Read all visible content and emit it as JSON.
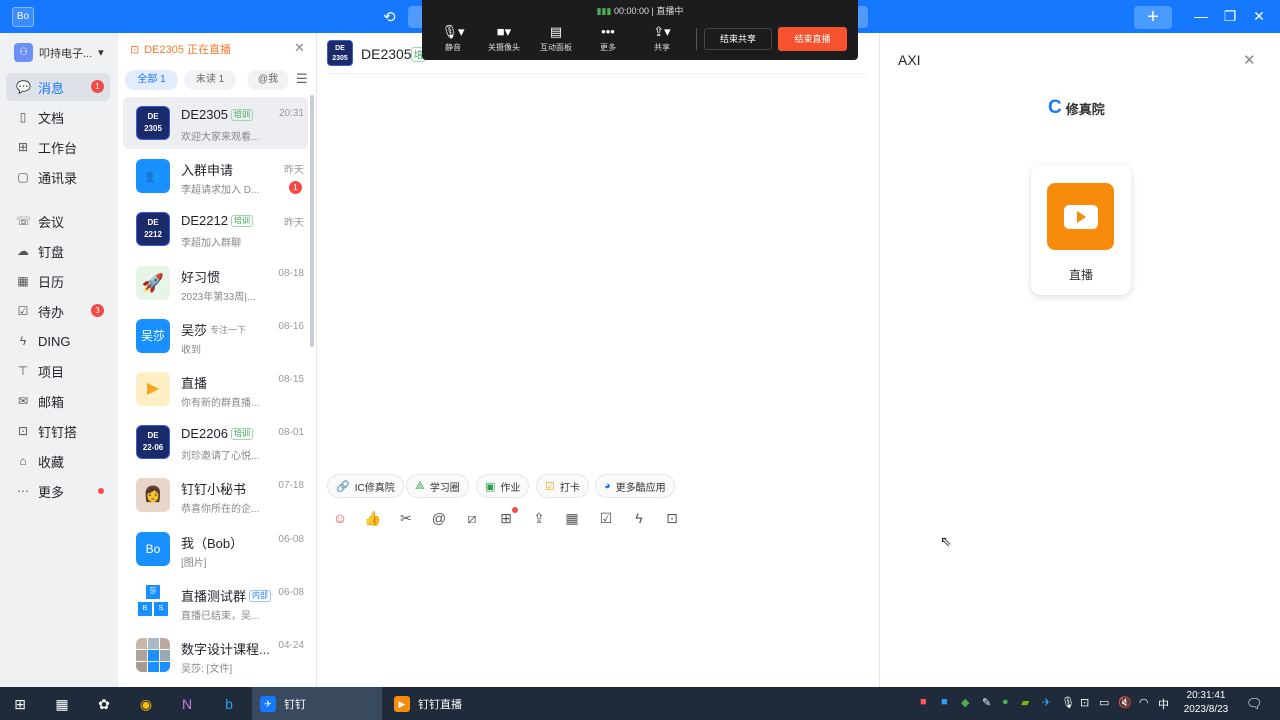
{
  "titlebar": {
    "logo": "Bo",
    "history_icon": "history-icon",
    "plus": "+"
  },
  "live_bar": {
    "timer": "00:00:00",
    "status": "直播中",
    "buttons": [
      {
        "icon": "microphone-icon",
        "label": "静音"
      },
      {
        "icon": "camera-icon",
        "label": "关摄像头"
      },
      {
        "icon": "whiteboard-icon",
        "label": "互动面板"
      },
      {
        "icon": "more-icon",
        "label": "更多"
      },
      {
        "icon": "share-icon",
        "label": "共享"
      }
    ],
    "end_share": "结束共享",
    "end_live": "结束直播"
  },
  "nav": {
    "org": "叩持电子...",
    "items": [
      {
        "label": "消息",
        "icon": "message-icon",
        "badge": "1",
        "active": true
      },
      {
        "label": "文档",
        "icon": "document-icon"
      },
      {
        "label": "工作台",
        "icon": "workbench-icon"
      },
      {
        "label": "通讯录",
        "icon": "contacts-icon"
      },
      {
        "label": "会议",
        "icon": "meeting-icon"
      },
      {
        "label": "钉盘",
        "icon": "cloud-disk-icon"
      },
      {
        "label": "日历",
        "icon": "calendar-icon"
      },
      {
        "label": "待办",
        "icon": "todo-icon",
        "badge": "3"
      },
      {
        "label": "DING",
        "icon": "ding-icon"
      },
      {
        "label": "项目",
        "icon": "project-icon"
      },
      {
        "label": "邮箱",
        "icon": "mail-icon"
      },
      {
        "label": "钉钉搭",
        "icon": "builder-icon"
      },
      {
        "label": "收藏",
        "icon": "favorites-icon"
      },
      {
        "label": "更多",
        "icon": "more-dots-icon",
        "dot": true
      }
    ]
  },
  "chatlist": {
    "banner": "DE2305 正在直播",
    "tabs": [
      {
        "label": "全部",
        "count": "1"
      },
      {
        "label": "未读",
        "count": "1"
      },
      {
        "label": "@我",
        "count": ""
      }
    ],
    "items": [
      {
        "name": "DE2305",
        "tag": "培训",
        "time": "20:31",
        "preview": "欢迎大家来观看...",
        "avatar": "DE\n2305"
      },
      {
        "name": "入群申请",
        "time": "昨天",
        "preview": "李超请求加入 D...",
        "badge": "1"
      },
      {
        "name": "DE2212",
        "tag": "培训",
        "time": "昨天",
        "preview": "李超加入群聊",
        "avatar": "DE\n2212"
      },
      {
        "name": "好习惯",
        "time": "08-18",
        "preview": "2023年第33周|..."
      },
      {
        "name": "吴莎",
        "status": "专注一下",
        "time": "08-16",
        "preview": "收到",
        "avatar": "吴莎"
      },
      {
        "name": "直播",
        "time": "08-15",
        "preview": "你有新的群直播..."
      },
      {
        "name": "DE2206",
        "tag": "培训",
        "time": "08-01",
        "preview": "刘珍邀请了心悦...",
        "avatar": "DE\n22-06"
      },
      {
        "name": "钉钉小秘书",
        "time": "07-18",
        "preview": "恭喜你所在的企..."
      },
      {
        "name": "我（Bob）",
        "time": "06-08",
        "preview": "[图片]",
        "avatar": "Bo"
      },
      {
        "name": "直播测试群",
        "tag": "内部",
        "time": "06-08",
        "preview": "直播已结束，吴..."
      },
      {
        "name": "数字设计课程...",
        "time": "04-24",
        "preview": "吴莎: [文件]"
      }
    ]
  },
  "chat": {
    "title": "DE2305",
    "tag": "培",
    "avatar": "DE\n2305",
    "quick": [
      {
        "icon": "link-icon",
        "label": "IC修真院"
      },
      {
        "icon": "study-circle-icon",
        "label": "学习圈"
      },
      {
        "icon": "homework-icon",
        "label": "作业"
      },
      {
        "icon": "checkin-icon",
        "label": "打卡"
      },
      {
        "icon": "apps-icon",
        "label": "更多酷应用"
      }
    ],
    "tools": [
      "emoji-icon",
      "thumbs-up-icon",
      "scissors-icon",
      "mention-icon",
      "slash-command-icon",
      "form-icon",
      "upload-icon",
      "calendar-icon",
      "task-check-icon",
      "ding-icon",
      "live-icon"
    ]
  },
  "panel": {
    "title": "AXI",
    "brand": "修真院",
    "card_label": "直播"
  },
  "taskbar": {
    "apps": [
      {
        "label": "钉钉",
        "active": true
      },
      {
        "label": "钉钉直播"
      }
    ],
    "ime": "中",
    "time": "20:31:41",
    "date": "2023/8/23"
  }
}
